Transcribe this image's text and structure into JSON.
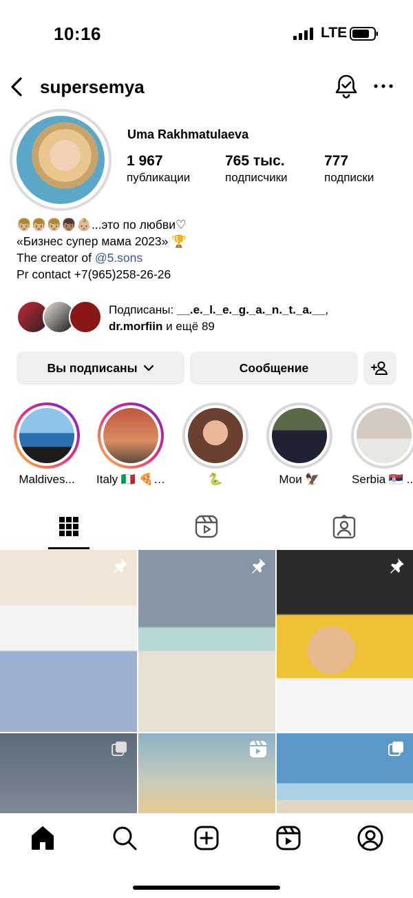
{
  "status_bar": {
    "time": "10:16",
    "network": "LTE"
  },
  "header": {
    "username": "supersemya"
  },
  "profile": {
    "full_name": "Uma Rakhmatulaeva",
    "stats": [
      {
        "value": "1 967",
        "label": "публикации"
      },
      {
        "value": "765 тыс.",
        "label": "подписчики"
      },
      {
        "value": "777",
        "label": "подписки"
      }
    ],
    "bio": {
      "line1": "👦🏼👦🏼👦🏼👦🏽👶🏼...это по любви♡",
      "line2": "«Бизнес супер мама 2023» 🏆",
      "line3_prefix": "The creator of ",
      "line3_link": "@5.sons",
      "line4": "Pr contact +7(965)258-26-26"
    },
    "followed_by": {
      "prefix": "Подписаны: ",
      "user1": "__.e._l._e._g._a._n._t._a.__",
      "sep": ",",
      "user2": "dr.morfiin",
      "suffix": " и ещё 89"
    }
  },
  "actions": {
    "subscribed_label": "Вы подписаны",
    "message_label": "Сообщение"
  },
  "highlights": [
    {
      "label": "Maldives..."
    },
    {
      "label": "Italy 🇮🇹 🍕 ..."
    },
    {
      "label": "🐍"
    },
    {
      "label": "Мои 🦅"
    },
    {
      "label": "Serbia 🇷🇸 ..."
    }
  ],
  "tabs": [
    "grid-icon",
    "reels-icon",
    "tagged-icon"
  ],
  "colors": {
    "link": "#385898",
    "button_bg": "#efefef",
    "story_gradient": [
      "#f9c53b",
      "#ee2a7b",
      "#6228d7"
    ]
  }
}
